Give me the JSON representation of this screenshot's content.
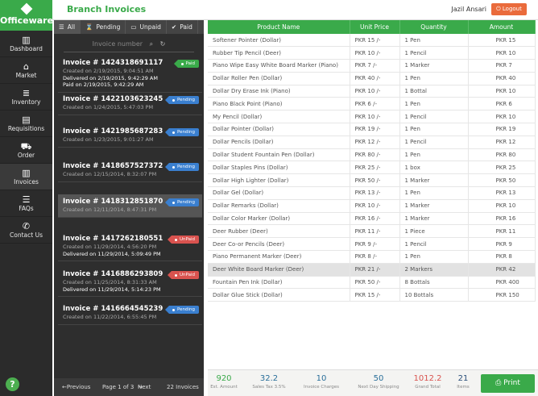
{
  "brand": {
    "name": "Officeware"
  },
  "nav": [
    {
      "label": "Dashboard",
      "icon": "dashboard-icon",
      "glyph": "▥"
    },
    {
      "label": "Market",
      "icon": "bank-icon",
      "glyph": "⌂"
    },
    {
      "label": "Inventory",
      "icon": "inventory-icon",
      "glyph": "≣"
    },
    {
      "label": "Requisitions",
      "icon": "requisitions-icon",
      "glyph": "▤"
    },
    {
      "label": "Order",
      "icon": "cart-icon",
      "glyph": "⛟"
    },
    {
      "label": "Invoices",
      "icon": "invoices-icon",
      "glyph": "▥"
    },
    {
      "label": "FAQs",
      "icon": "faq-icon",
      "glyph": "☰"
    },
    {
      "label": "Contact Us",
      "icon": "phone-icon",
      "glyph": "✆"
    }
  ],
  "help": "?",
  "header": {
    "title": "Branch Invoices",
    "user": "Jazil Ansari",
    "logout": "Logout"
  },
  "filters": [
    {
      "label": "All",
      "glyph": "☰"
    },
    {
      "label": "Pending",
      "glyph": "⌛"
    },
    {
      "label": "Unpaid",
      "glyph": "▭"
    },
    {
      "label": "Paid",
      "glyph": "✔"
    }
  ],
  "search": {
    "placeholder": "Invoice number"
  },
  "invoices": [
    {
      "number": "Invoice # 1424318691117",
      "lines": [
        "Created on 2/19/2015, 9:04:51 AM",
        "Delivered on 2/19/2015, 9:42:29 AM",
        "Paid on 2/19/2015, 9:42:29 AM"
      ],
      "status": "Paid"
    },
    {
      "number": "Invoice # 1422103623245",
      "lines": [
        "Created on 1/24/2015, 5:47:03 PM"
      ],
      "status": "Pending"
    },
    {
      "number": "Invoice # 1421985687283",
      "lines": [
        "Created on 1/23/2015, 9:01:27 AM"
      ],
      "status": "Pending"
    },
    {
      "number": "Invoice # 1418657527372",
      "lines": [
        "Created on 12/15/2014, 8:32:07 PM"
      ],
      "status": "Pending"
    },
    {
      "number": "Invoice # 1418312851870",
      "lines": [
        "Created on 12/11/2014, 8:47:31 PM"
      ],
      "status": "Pending"
    },
    {
      "number": "Invoice # 1417262180551",
      "lines": [
        "Created on 11/29/2014, 4:56:20 PM",
        "Delivered on 11/29/2014, 5:09:49 PM"
      ],
      "status": "UnPaid"
    },
    {
      "number": "Invoice # 1416886293809",
      "lines": [
        "Created on 11/25/2014, 8:31:33 AM",
        "Delivered on 11/29/2014, 5:14:23 PM"
      ],
      "status": "UnPaid"
    },
    {
      "number": "Invoice # 1416664545239",
      "lines": [
        "Created on 11/22/2014, 6:55:45 PM"
      ],
      "status": "Pending"
    }
  ],
  "pager": {
    "previous": "Previous",
    "page": "Page 1 of 3",
    "next": "Next",
    "total": "22 Invoices"
  },
  "table": {
    "headers": [
      "Product Name",
      "Unit Price",
      "Quantity",
      "Amount"
    ],
    "rows": [
      [
        "Softener Pointer (Dollar)",
        "PKR 15 /-",
        "1 Pen",
        "PKR 15"
      ],
      [
        "Rubber Tip Pencil (Deer)",
        "PKR 10 /-",
        "1 Pencil",
        "PKR 10"
      ],
      [
        "Piano Wipe Easy White Board Marker (Piano)",
        "PKR 7 /-",
        "1 Marker",
        "PKR 7"
      ],
      [
        "Dollar Roller Pen (Dollar)",
        "PKR 40 /-",
        "1 Pen",
        "PKR 40"
      ],
      [
        "Dollar Dry Erase Ink (Piano)",
        "PKR 10 /-",
        "1 Bottal",
        "PKR 10"
      ],
      [
        "Piano Black Point (Piano)",
        "PKR 6 /-",
        "1 Pen",
        "PKR 6"
      ],
      [
        "My Pencil (Dollar)",
        "PKR 10 /-",
        "1 Pencil",
        "PKR 10"
      ],
      [
        "Dollar Pointer (Dollar)",
        "PKR 19 /-",
        "1 Pen",
        "PKR 19"
      ],
      [
        "Dollar Pencils (Dollar)",
        "PKR 12 /-",
        "1 Pencil",
        "PKR 12"
      ],
      [
        "Dollar Student Fountain Pen (Dollar)",
        "PKR 80 /-",
        "1 Pen",
        "PKR 80"
      ],
      [
        "Dollar Staples Pins (Dollar)",
        "PKR 25 /-",
        "1 box",
        "PKR 25"
      ],
      [
        "Dollar High Lighter (Dollar)",
        "PKR 50 /-",
        "1 Marker",
        "PKR 50"
      ],
      [
        "Dollar Gel (Dollar)",
        "PKR 13 /-",
        "1 Pen",
        "PKR 13"
      ],
      [
        "Dollar Remarks (Dollar)",
        "PKR 10 /-",
        "1 Marker",
        "PKR 10"
      ],
      [
        "Dollar Color Marker (Dollar)",
        "PKR 16 /-",
        "1 Marker",
        "PKR 16"
      ],
      [
        "Deer Rubber (Deer)",
        "PKR 11 /-",
        "1 Piece",
        "PKR 11"
      ],
      [
        "Deer Co-or Pencils (Deer)",
        "PKR 9 /-",
        "1 Pencil",
        "PKR 9"
      ],
      [
        "Piano Permanent Marker (Deer)",
        "PKR 8 /-",
        "1 Pen",
        "PKR 8"
      ],
      [
        "Deer White Board Marker (Deer)",
        "PKR 21 /-",
        "2 Markers",
        "PKR 42"
      ],
      [
        "Fountain Pen Ink (Dollar)",
        "PKR 50 /-",
        "8 Bottals",
        "PKR 400"
      ],
      [
        "Dollar Glue Stick (Dollar)",
        "PKR 15 /-",
        "10 Bottals",
        "PKR 150"
      ]
    ],
    "highlight_row": 18
  },
  "summary": [
    {
      "value": "920",
      "label": "Est. Amount",
      "color": "#3aaa4a"
    },
    {
      "value": "32.2",
      "label": "Sales Tax 3.5%",
      "color": "#2a6f9a"
    },
    {
      "value": "10",
      "label": "Invoice Charges",
      "color": "#2a6f9a"
    },
    {
      "value": "50",
      "label": "Next Day Shipping",
      "color": "#2a6f9a"
    },
    {
      "value": "1012.2",
      "label": "Grand Total",
      "color": "#d9534f"
    },
    {
      "value": "21",
      "label": "Items",
      "color": "#2a4f7a"
    }
  ],
  "print": "Print",
  "colors": {
    "brand": "#3aaa4a",
    "pending": "#3a7fcf",
    "unpaid": "#d9534f",
    "logout": "#ea6b3c"
  }
}
